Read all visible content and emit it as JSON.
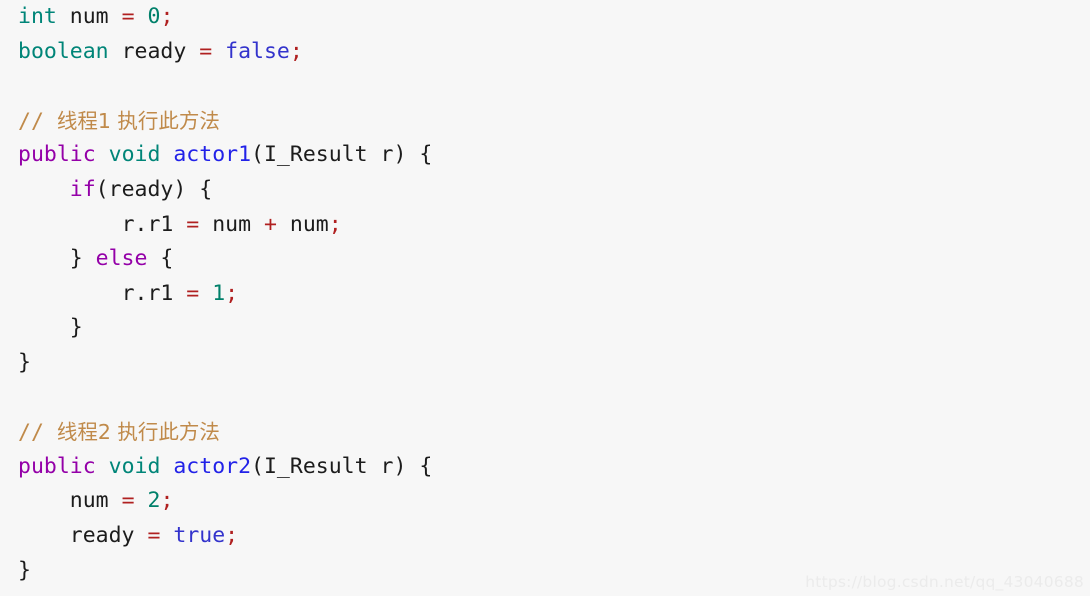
{
  "editor": {
    "background_color": "#f7f7f7",
    "language": "java",
    "font_size_px": 21.5,
    "line_height_px": 34.6,
    "colors": {
      "plain": "#1c1c1c",
      "type": "#008578",
      "keyword": "#9400a8",
      "method": "#2222e8",
      "literal": "#3333cc",
      "number": "#00806a",
      "operator": "#b02020",
      "comment": "#c08a4a",
      "watermark": "#ebebeb"
    }
  },
  "code": {
    "lines": [
      {
        "id": "line-1",
        "tokens": [
          {
            "text": "int",
            "type": "type"
          },
          {
            "text": " ",
            "type": "plain"
          },
          {
            "text": "num",
            "type": "plain"
          },
          {
            "text": " ",
            "type": "plain"
          },
          {
            "text": "=",
            "type": "operator"
          },
          {
            "text": " ",
            "type": "plain"
          },
          {
            "text": "0",
            "type": "number"
          },
          {
            "text": ";",
            "type": "operator"
          }
        ]
      },
      {
        "id": "line-2",
        "tokens": [
          {
            "text": "boolean",
            "type": "type"
          },
          {
            "text": " ",
            "type": "plain"
          },
          {
            "text": "ready",
            "type": "plain"
          },
          {
            "text": " ",
            "type": "plain"
          },
          {
            "text": "=",
            "type": "operator"
          },
          {
            "text": " ",
            "type": "plain"
          },
          {
            "text": "false",
            "type": "literal"
          },
          {
            "text": ";",
            "type": "operator"
          }
        ]
      },
      {
        "id": "line-3",
        "tokens": []
      },
      {
        "id": "line-4",
        "tokens": [
          {
            "text": "// ",
            "type": "comment"
          },
          {
            "text": "线程1 执行此方法",
            "type": "comment",
            "cjk": true
          }
        ]
      },
      {
        "id": "line-5",
        "tokens": [
          {
            "text": "public",
            "type": "keyword"
          },
          {
            "text": " ",
            "type": "plain"
          },
          {
            "text": "void",
            "type": "type"
          },
          {
            "text": " ",
            "type": "plain"
          },
          {
            "text": "actor1",
            "type": "method"
          },
          {
            "text": "(",
            "type": "punct"
          },
          {
            "text": "I_Result",
            "type": "plain"
          },
          {
            "text": " ",
            "type": "plain"
          },
          {
            "text": "r",
            "type": "plain"
          },
          {
            "text": ") {",
            "type": "punct"
          }
        ]
      },
      {
        "id": "line-6",
        "tokens": [
          {
            "text": "    ",
            "type": "plain"
          },
          {
            "text": "if",
            "type": "keyword"
          },
          {
            "text": "(",
            "type": "punct"
          },
          {
            "text": "ready",
            "type": "plain"
          },
          {
            "text": ") {",
            "type": "punct"
          }
        ]
      },
      {
        "id": "line-7",
        "tokens": [
          {
            "text": "        ",
            "type": "plain"
          },
          {
            "text": "r.r1",
            "type": "plain"
          },
          {
            "text": " ",
            "type": "plain"
          },
          {
            "text": "=",
            "type": "operator"
          },
          {
            "text": " ",
            "type": "plain"
          },
          {
            "text": "num",
            "type": "plain"
          },
          {
            "text": " ",
            "type": "plain"
          },
          {
            "text": "+",
            "type": "operator"
          },
          {
            "text": " ",
            "type": "plain"
          },
          {
            "text": "num",
            "type": "plain"
          },
          {
            "text": ";",
            "type": "operator"
          }
        ]
      },
      {
        "id": "line-8",
        "tokens": [
          {
            "text": "    } ",
            "type": "punct"
          },
          {
            "text": "else",
            "type": "keyword"
          },
          {
            "text": " {",
            "type": "punct"
          }
        ]
      },
      {
        "id": "line-9",
        "tokens": [
          {
            "text": "        ",
            "type": "plain"
          },
          {
            "text": "r.r1",
            "type": "plain"
          },
          {
            "text": " ",
            "type": "plain"
          },
          {
            "text": "=",
            "type": "operator"
          },
          {
            "text": " ",
            "type": "plain"
          },
          {
            "text": "1",
            "type": "number"
          },
          {
            "text": ";",
            "type": "operator"
          }
        ]
      },
      {
        "id": "line-10",
        "tokens": [
          {
            "text": "    }",
            "type": "punct"
          }
        ]
      },
      {
        "id": "line-11",
        "tokens": [
          {
            "text": "}",
            "type": "punct"
          }
        ]
      },
      {
        "id": "line-12",
        "tokens": []
      },
      {
        "id": "line-13",
        "tokens": [
          {
            "text": "// ",
            "type": "comment"
          },
          {
            "text": "线程2 执行此方法",
            "type": "comment",
            "cjk": true
          }
        ]
      },
      {
        "id": "line-14",
        "tokens": [
          {
            "text": "public",
            "type": "keyword"
          },
          {
            "text": " ",
            "type": "plain"
          },
          {
            "text": "void",
            "type": "type"
          },
          {
            "text": " ",
            "type": "plain"
          },
          {
            "text": "actor2",
            "type": "method"
          },
          {
            "text": "(",
            "type": "punct"
          },
          {
            "text": "I_Result",
            "type": "plain"
          },
          {
            "text": " ",
            "type": "plain"
          },
          {
            "text": "r",
            "type": "plain"
          },
          {
            "text": ") {",
            "type": "punct"
          }
        ]
      },
      {
        "id": "line-15",
        "tokens": [
          {
            "text": "    ",
            "type": "plain"
          },
          {
            "text": "num",
            "type": "plain"
          },
          {
            "text": " ",
            "type": "plain"
          },
          {
            "text": "=",
            "type": "operator"
          },
          {
            "text": " ",
            "type": "plain"
          },
          {
            "text": "2",
            "type": "number"
          },
          {
            "text": ";",
            "type": "operator"
          }
        ]
      },
      {
        "id": "line-16",
        "tokens": [
          {
            "text": "    ",
            "type": "plain"
          },
          {
            "text": "ready",
            "type": "plain"
          },
          {
            "text": " ",
            "type": "plain"
          },
          {
            "text": "=",
            "type": "operator"
          },
          {
            "text": " ",
            "type": "plain"
          },
          {
            "text": "true",
            "type": "literal"
          },
          {
            "text": ";",
            "type": "operator"
          }
        ]
      },
      {
        "id": "line-17",
        "tokens": [
          {
            "text": "}",
            "type": "punct"
          }
        ]
      }
    ]
  },
  "watermark": {
    "text": "https://blog.csdn.net/qq_43040688"
  }
}
